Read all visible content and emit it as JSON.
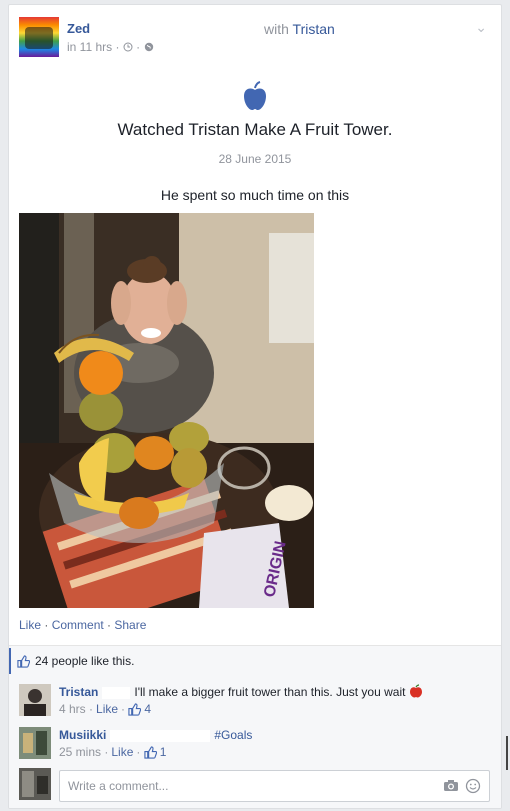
{
  "post": {
    "author": "Zed",
    "with_prefix": "with",
    "with_name": "Tristan",
    "time": "in 11 hrs",
    "event_title": "Watched Tristan Make A Fruit Tower.",
    "event_date": "28 June 2015",
    "status_text": "He spent so much time on this",
    "actions": {
      "like": "Like",
      "comment": "Comment",
      "share": "Share"
    },
    "likes_text": "24 people like this."
  },
  "comments": [
    {
      "name": "Tristan",
      "text": "I'll make a bigger fruit tower than this. Just you wait",
      "time": "4 hrs",
      "like": "Like",
      "count": "4"
    },
    {
      "name": "Musiikki",
      "text": "#Goals",
      "time": "25 mins",
      "like": "Like",
      "count": "1"
    }
  ],
  "composer": {
    "placeholder": "Write a comment..."
  },
  "colors": {
    "link": "#365899",
    "brand": "#4267b2",
    "muted": "#90949c"
  }
}
